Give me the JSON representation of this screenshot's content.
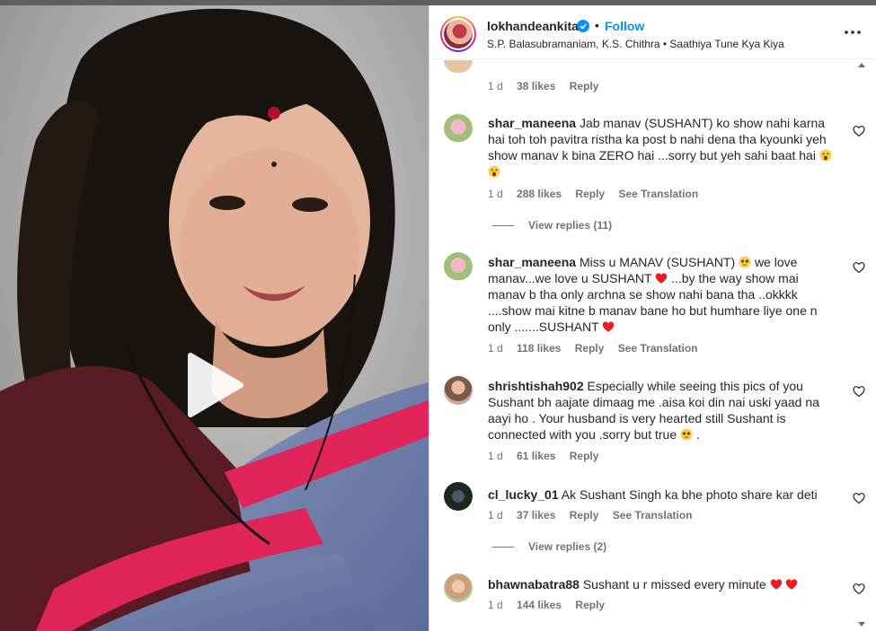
{
  "post": {
    "username": "lokhandeankita",
    "separator": "•",
    "follow_label": "Follow",
    "audio_line": "S.P. Balasubramaniam, K.S. Chithra • Saathiya Tune Kya Kiya",
    "more_icon": "more-horizontal-icon",
    "verified_icon": "verified-badge-icon"
  },
  "comments": [
    {
      "username": "",
      "text": "",
      "time": "1 d",
      "likes": "38 likes",
      "reply": "Reply",
      "translation": "",
      "view_replies": ""
    },
    {
      "username": "shar_maneena",
      "text": "Jab manav (SUSHANT) ko show nahi karna hai toh toh pavitra ristha ka post b nahi dena tha kyounki yeh show manav k bina ZERO hai ...sorry but yeh sahi baat hai",
      "time": "1 d",
      "likes": "288 likes",
      "reply": "Reply",
      "translation": "See Translation",
      "view_replies": "View replies (11)"
    },
    {
      "username": "shar_maneena",
      "text_a": "Miss u MANAV (SUSHANT)",
      "text_b": "we love manav...we love u SUSHANT",
      "text_c": "...by the way show mai manav b tha only archna se show nahi bana tha ..okkkk ....show mai kitne b manav bane ho but humhare liye one n only .......SUSHANT",
      "time": "1 d",
      "likes": "118 likes",
      "reply": "Reply",
      "translation": "See Translation",
      "view_replies": ""
    },
    {
      "username": "shrishtishah902",
      "text": "Especially while seeing this pics of you Sushant bh aajate dimaag me .aisa koi din nai uski yaad na aayi ho . Your husband is very hearted still Sushant is connected with you .sorry but true",
      "text_end": ".",
      "time": "1 d",
      "likes": "61 likes",
      "reply": "Reply",
      "translation": "",
      "view_replies": ""
    },
    {
      "username": "cl_lucky_01",
      "text": "Ak Sushant Singh ka bhe photo share kar deti",
      "time": "1 d",
      "likes": "37 likes",
      "reply": "Reply",
      "translation": "See Translation",
      "view_replies": "View replies (2)"
    },
    {
      "username": "bhawnabatra88",
      "text": "Sushant u r missed every minute",
      "time": "1 d",
      "likes": "144 likes",
      "reply": "Reply",
      "translation": "",
      "view_replies": ""
    }
  ],
  "icons": {
    "like": "heart-outline-icon",
    "play": "play-icon",
    "emoji_shock": "face-screaming-emoji",
    "emoji_sad": "pleading-face-emoji",
    "emoji_heart": "red-heart-emoji"
  },
  "colors": {
    "accent": "#0095f6",
    "text": "#262626",
    "muted": "#737373",
    "heart": "#ed1c24"
  }
}
